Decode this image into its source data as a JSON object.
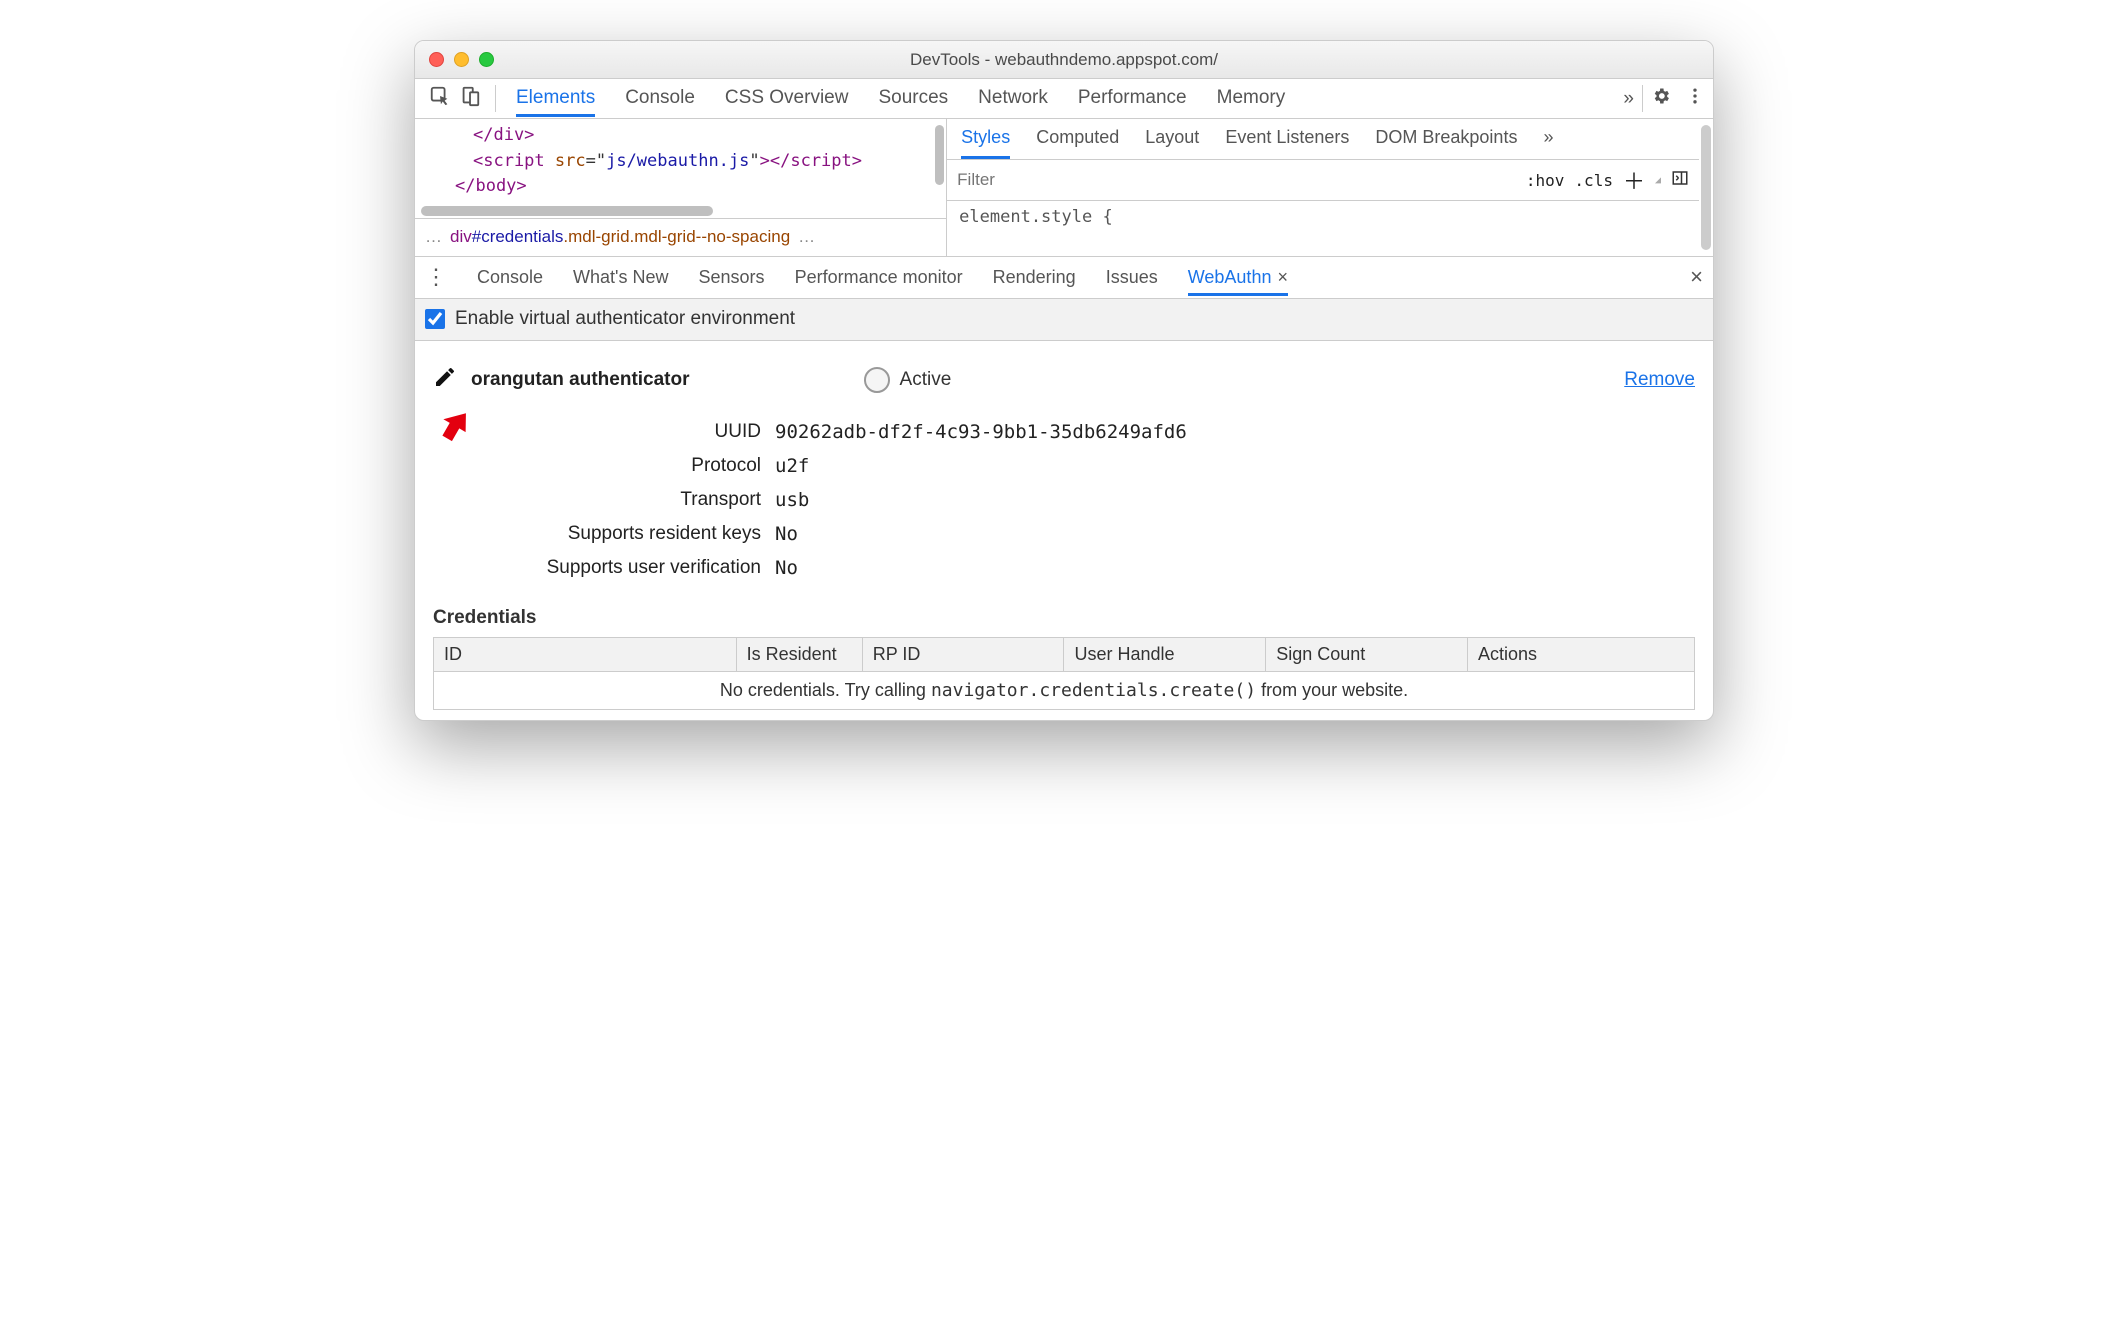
{
  "titlebar": {
    "title": "DevTools - webauthndemo.appspot.com/"
  },
  "mainTabs": {
    "items": [
      "Elements",
      "Console",
      "CSS Overview",
      "Sources",
      "Network",
      "Performance",
      "Memory"
    ],
    "activeIndex": 0
  },
  "source": {
    "lines_html": [
      "<span class='tag'>&lt;/div&gt;</span>",
      "<span class='tag'>&lt;script </span><span class='attr'>src</span>=\"<span class='val'>js/webauthn.js</span>\"<span class='tag'>&gt;&lt;/script&gt;</span>",
      "<span class='tag'>&lt;/body&gt;</span>"
    ],
    "breadcrumb": {
      "prefix": "…",
      "tag": "div",
      "id": "#credentials",
      "cls1": ".mdl-grid",
      "cls2": ".mdl-grid--no-spacing",
      "suffix": "…"
    }
  },
  "styles": {
    "tabs": [
      "Styles",
      "Computed",
      "Layout",
      "Event Listeners",
      "DOM Breakpoints"
    ],
    "activeIndex": 0,
    "filter_placeholder": "Filter",
    "hov": ":hov",
    "cls": ".cls",
    "body_text": "element.style {"
  },
  "drawer": {
    "tabs": [
      "Console",
      "What's New",
      "Sensors",
      "Performance monitor",
      "Rendering",
      "Issues",
      "WebAuthn"
    ],
    "activeIndex": 6,
    "closeSymbol": "×"
  },
  "webauthn": {
    "enable_label": "Enable virtual authenticator environment",
    "enable_checked": true,
    "auth_name": "orangutan authenticator",
    "active_label": "Active",
    "remove_label": "Remove",
    "fields": [
      {
        "label": "UUID",
        "value": "90262adb-df2f-4c93-9bb1-35db6249afd6"
      },
      {
        "label": "Protocol",
        "value": "u2f"
      },
      {
        "label": "Transport",
        "value": "usb"
      },
      {
        "label": "Supports resident keys",
        "value": "No"
      },
      {
        "label": "Supports user verification",
        "value": "No"
      }
    ],
    "credentials_heading": "Credentials",
    "credentials_columns": [
      "ID",
      "Is Resident",
      "RP ID",
      "User Handle",
      "Sign Count",
      "Actions"
    ],
    "credentials_empty_pre": "No credentials. Try calling ",
    "credentials_empty_call": "navigator.credentials.create()",
    "credentials_empty_post": " from your website."
  }
}
